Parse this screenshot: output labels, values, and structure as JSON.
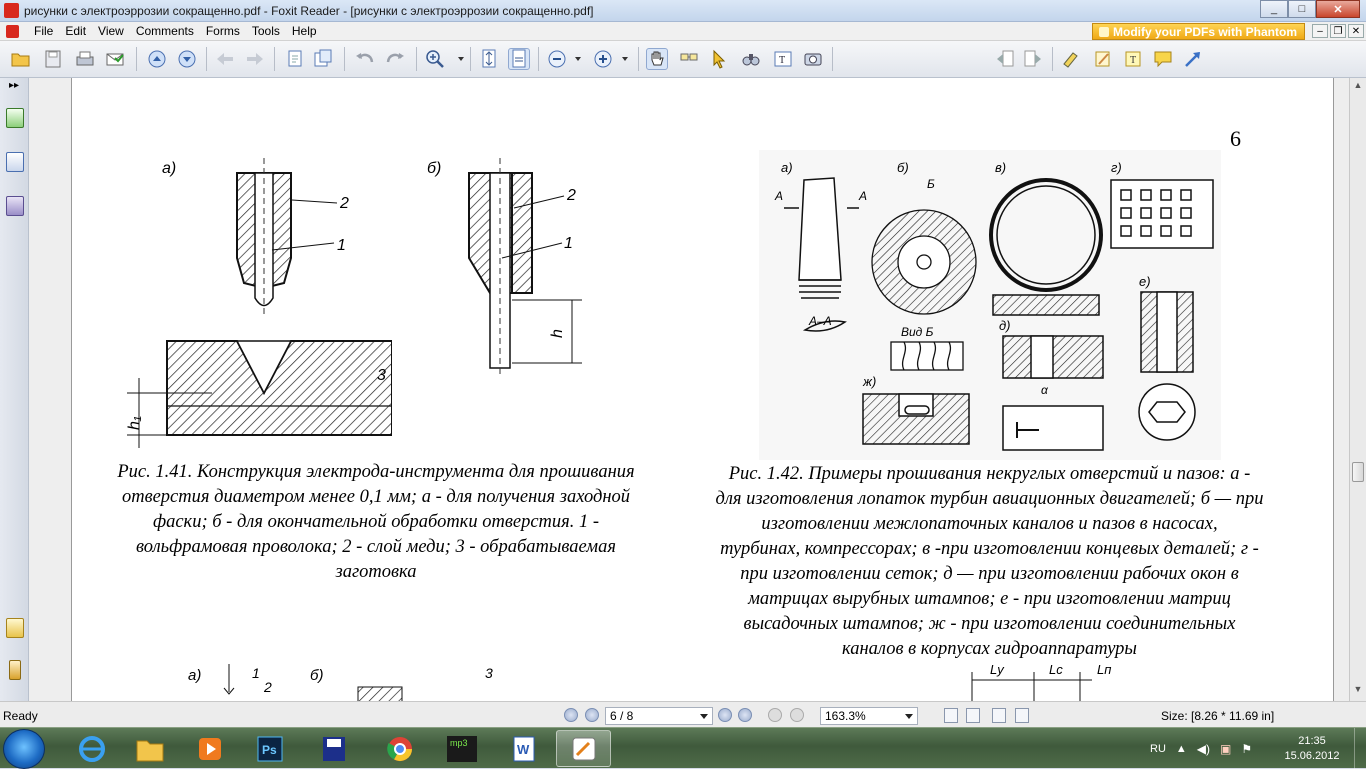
{
  "window": {
    "title": "рисунки с электроэррозии сокращенно.pdf - Foxit Reader - [рисунки с электроэррозии сокращенно.pdf]",
    "minimize": "_",
    "maximize": "□",
    "close": "✕"
  },
  "menu": {
    "items": [
      "File",
      "Edit",
      "View",
      "Comments",
      "Forms",
      "Tools",
      "Help"
    ],
    "promo": "Modify your PDFs with Phantom"
  },
  "toolbar": {
    "find_placeholder": "Find",
    "icons": [
      "open-icon",
      "save-icon",
      "print-icon",
      "email-icon",
      "prev-page-icon",
      "next-page-icon",
      "back-icon",
      "forward-icon",
      "rotate-icon",
      "extract-icon",
      "undo-icon",
      "redo-icon",
      "zoom-in-icon",
      "fit-page-icon",
      "fit-width-icon",
      "zoom-out-icon",
      "zoom-in-plus-icon",
      "hand-tool-icon",
      "text-select-icon",
      "pointer-icon",
      "binoculars-icon",
      "typewriter-icon",
      "snapshot-icon",
      "find-prev-icon",
      "find-next-icon",
      "highlight-icon",
      "pencil-icon",
      "text-box-icon",
      "note-icon",
      "arrow-tool-icon"
    ]
  },
  "document": {
    "page_number": "6",
    "fig41": {
      "labels": {
        "a": "а)",
        "b": "б)",
        "n1": "1",
        "n2": "2",
        "n3": "3",
        "h": "h",
        "h1": "h₁"
      },
      "caption": [
        "Рис. 1.41. Конструкция электрода-инструмента для прошивания",
        "отверстия диаметром менее 0,1 мм; а - для получения заходной",
        "фаски; б - для окончательной обработки отверстия. 1 -",
        "вольфрамовая проволока; 2 - слой меди; 3 - обрабатываемая",
        "заготовка"
      ]
    },
    "fig42": {
      "labels": {
        "a": "а)",
        "b": "б)",
        "v": "в)",
        "g": "г)",
        "d": "д)",
        "e": "е)",
        "zh": "ж)",
        "aa": "А–А",
        "vidb": "Вид Б",
        "A": "А",
        "B": "Б",
        "alpha": "α"
      },
      "caption": [
        "Рис. 1.42. Примеры прошивания некруглых отверстий и пазов: а -",
        "для изготовления лопаток турбин авиационных двигателей; б — при",
        "изготовлении межлопаточных каналов и пазов в насосах,",
        "турбинах, компрессорах; в -при изготовлении концевых деталей; г -",
        "при изготовлении сеток; д — при изготовлении рабочих окон в",
        "матрицах вырубных штампов; е - при изготовлении матриц",
        "высадочных штампов; ж - при изготовлении соединительных",
        "каналов в корпусах гидроаппаратуры"
      ]
    },
    "next_fig_labels": {
      "a": "а)",
      "b": "б)",
      "n1": "1",
      "n2": "2",
      "n3": "3",
      "ly": "Lу",
      "lc": "Lс",
      "ln": "Lп"
    }
  },
  "status": {
    "ready": "Ready",
    "page": "6 / 8",
    "zoom": "163.3%",
    "size": "Size: [8.26 * 11.69 in]"
  },
  "taskbar": {
    "apps": [
      "explorer-icon",
      "internet-explorer-icon",
      "file-manager-icon",
      "media-player-icon",
      "photoshop-icon",
      "floppy-save-icon",
      "chrome-icon",
      "mp3-cut-icon",
      "word-icon",
      "foxit-reader-icon"
    ],
    "ps_label": "Ps",
    "mp3_label": "mp3",
    "time": "21:35",
    "date": "15.06.2012"
  },
  "colors": {
    "accent": "#f0a916",
    "titlebar": "#c3d5ec",
    "taskbar": "#4f6b48"
  }
}
